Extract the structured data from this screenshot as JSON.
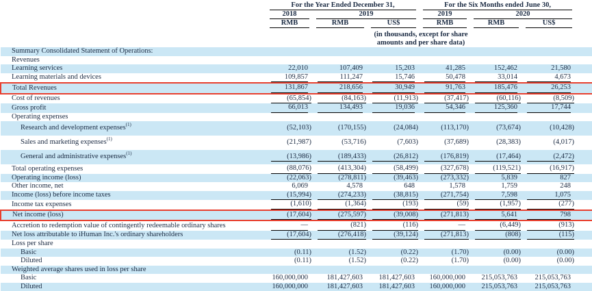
{
  "colors": {
    "stripe_blue": "#cbe7f5",
    "highlight_red": "#e8402f",
    "rule_black": "#000000",
    "text_navy": "#1a2a42"
  },
  "header": {
    "period_year": "For the Year Ended December 31,",
    "period_six_months": "For the Six Months ended June 30,",
    "year_cols": [
      "2018",
      "2019",
      "2019",
      "2020"
    ],
    "currency_cols": [
      "RMB",
      "RMB",
      "US$",
      "RMB",
      "RMB",
      "US$"
    ],
    "units_note": "(in thousands, except for share amounts and per share data)"
  },
  "table": {
    "rows": [
      {
        "label": "Summary Consolidated Statement of Operations:",
        "bold": true,
        "stripe": true,
        "values": [
          "",
          "",
          "",
          "",
          "",
          ""
        ]
      },
      {
        "label": "Revenues",
        "bold": true,
        "values": [
          "",
          "",
          "",
          "",
          "",
          ""
        ]
      },
      {
        "label": "Learning services",
        "stripe": true,
        "values": [
          "22,010",
          "107,409",
          "15,203",
          "41,285",
          "152,462",
          "21,580"
        ]
      },
      {
        "label": "Learning materials and devices",
        "underline": true,
        "values": [
          "109,857",
          "111,247",
          "15,746",
          "50,478",
          "33,014",
          "4,673"
        ]
      },
      {
        "label": "Total Revenues",
        "bold": true,
        "stripe": true,
        "redbox": true,
        "underline": true,
        "values": [
          "131,867",
          "218,656",
          "30,949",
          "91,763",
          "185,476",
          "26,253"
        ]
      },
      {
        "label": "Cost of revenues",
        "bold": true,
        "underline": true,
        "values": [
          "(65,854)",
          "(84,163)",
          "(11,913)",
          "(37,417)",
          "(60,116)",
          "(8,509)"
        ]
      },
      {
        "label": "Gross profit",
        "bold": true,
        "stripe": true,
        "underline": true,
        "values": [
          "66,013",
          "134,493",
          "19,036",
          "54,346",
          "125,360",
          "17,744"
        ]
      },
      {
        "label": "Operating expenses",
        "bold": true,
        "values": [
          "",
          "",
          "",
          "",
          "",
          ""
        ]
      },
      {
        "label": "Research and development expenses",
        "sup": "(1)",
        "indent": true,
        "stripe": true,
        "tall": true,
        "values": [
          "(52,103)",
          "(170,155)",
          "(24,084)",
          "(113,170)",
          "(73,674)",
          "(10,428)"
        ]
      },
      {
        "label": "Sales and marketing expenses",
        "sup": "(1)",
        "indent": true,
        "tall": true,
        "values": [
          "(21,987)",
          "(53,716)",
          "(7,603)",
          "(37,689)",
          "(28,383)",
          "(4,017)"
        ]
      },
      {
        "label": "General and administrative expenses",
        "sup": "(1)",
        "indent": true,
        "stripe": true,
        "tall": true,
        "underline": true,
        "values": [
          "(13,986)",
          "(189,433)",
          "(26,812)",
          "(176,819)",
          "(17,464)",
          "(2,472)"
        ]
      },
      {
        "label": "Total operating expenses",
        "bold": true,
        "underline": true,
        "values": [
          "(88,076)",
          "(413,304)",
          "(58,499)",
          "(327,678)",
          "(119,521)",
          "(16,917)"
        ]
      },
      {
        "label": "Operating income (loss)",
        "bold": true,
        "stripe": true,
        "values": [
          "(22,063)",
          "(278,811)",
          "(39,463)",
          "(273,332)",
          "5,839",
          "827"
        ]
      },
      {
        "label": "Other income, net",
        "values": [
          "6,069",
          "4,578",
          "648",
          "1,578",
          "1,759",
          "248"
        ]
      },
      {
        "label": "Income (loss) before income taxes",
        "bold": true,
        "stripe": true,
        "underline": true,
        "values": [
          "(15,994)",
          "(274,233)",
          "(38,815)",
          "(271,754)",
          "7,598",
          "1,075"
        ]
      },
      {
        "label": "Income tax expenses",
        "underline": true,
        "values": [
          "(1,610)",
          "(1,364)",
          "(193)",
          "(59)",
          "(1,957)",
          "(277)"
        ]
      },
      {
        "label": "Net income (loss)",
        "bold": true,
        "stripe": true,
        "redbox": true,
        "underline": true,
        "values": [
          "(17,604)",
          "(275,597)",
          "(39,008)",
          "(271,813)",
          "5,641",
          "798"
        ]
      },
      {
        "label": "Accretion to redemption value of contingently redeemable ordinary shares",
        "underline": true,
        "values": [
          "—",
          "(821)",
          "(116)",
          "—",
          "(6,449)",
          "(913)"
        ]
      },
      {
        "label": "Net loss attributable to iHuman Inc.'s ordinary shareholders",
        "bold": true,
        "stripe": true,
        "underline": true,
        "values": [
          "(17,604)",
          "(276,418)",
          "(39,124)",
          "(271,813)",
          "(808)",
          "(115)"
        ]
      },
      {
        "label": "Loss per share",
        "bold": true,
        "values": [
          "",
          "",
          "",
          "",
          "",
          ""
        ]
      },
      {
        "label": "Basic",
        "indent": true,
        "stripe": true,
        "values": [
          "(0.11)",
          "(1.52)",
          "(0.22)",
          "(1.70)",
          "(0.00)",
          "(0.00)"
        ]
      },
      {
        "label": "Diluted",
        "indent": true,
        "values": [
          "(0.11)",
          "(1.52)",
          "(0.22)",
          "(1.70)",
          "(0.00)",
          "(0.00)"
        ]
      },
      {
        "label": "Weighted average shares used in loss per share",
        "bold": true,
        "stripe": true,
        "values": [
          "",
          "",
          "",
          "",
          "",
          ""
        ]
      },
      {
        "label": "Basic",
        "indent": true,
        "values": [
          "160,000,000",
          "181,427,603",
          "181,427,603",
          "160,000,000",
          "215,053,763",
          "215,053,763"
        ]
      },
      {
        "label": "Diluted",
        "indent": true,
        "stripe": true,
        "values": [
          "160,000,000",
          "181,427,603",
          "181,427,603",
          "160,000,000",
          "215,053,763",
          "215,053,763"
        ]
      }
    ]
  }
}
